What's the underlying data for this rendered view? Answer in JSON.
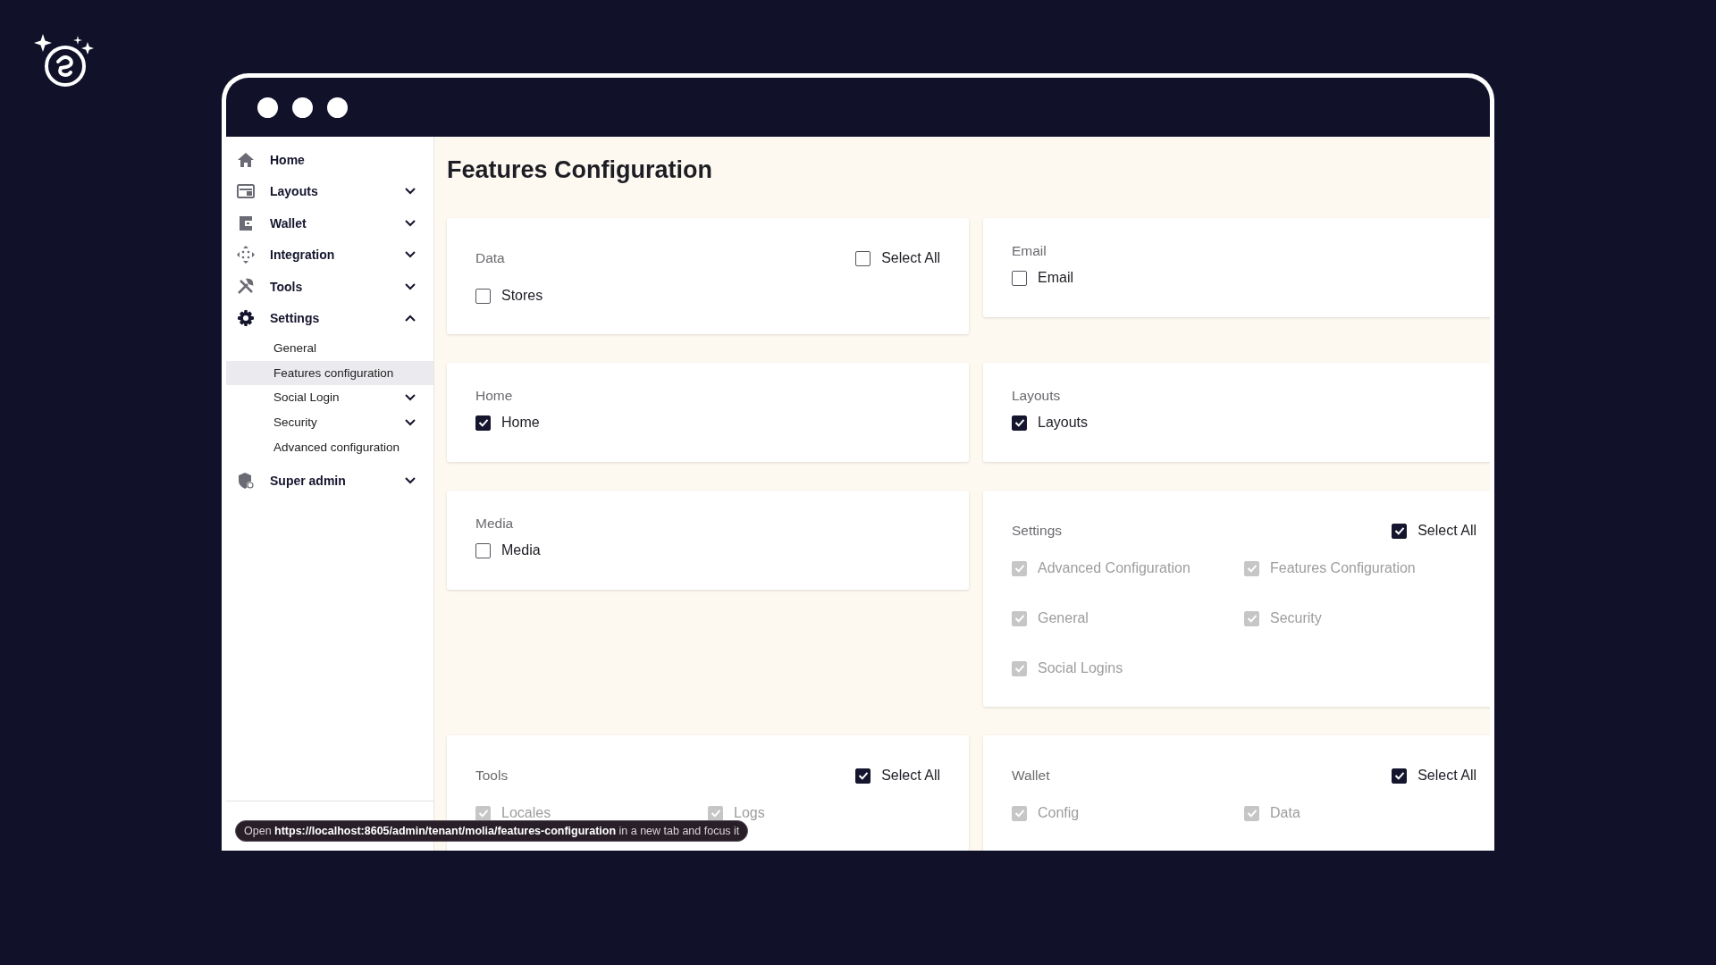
{
  "sidebar": {
    "items": [
      {
        "label": "Home",
        "kind": "link"
      },
      {
        "label": "Layouts",
        "kind": "group",
        "expanded": false
      },
      {
        "label": "Wallet",
        "kind": "group",
        "expanded": false
      },
      {
        "label": "Integration",
        "kind": "group",
        "expanded": false
      },
      {
        "label": "Tools",
        "kind": "group",
        "expanded": false
      },
      {
        "label": "Settings",
        "kind": "group",
        "expanded": true,
        "children": [
          {
            "label": "General",
            "kind": "link",
            "selected": false
          },
          {
            "label": "Features configuration",
            "kind": "link",
            "selected": true
          },
          {
            "label": "Social Login",
            "kind": "group",
            "selected": false
          },
          {
            "label": "Security",
            "kind": "group",
            "selected": false
          },
          {
            "label": "Advanced configuration",
            "kind": "link",
            "selected": false
          }
        ]
      },
      {
        "label": "Super admin",
        "kind": "group",
        "expanded": false
      }
    ]
  },
  "page": {
    "title": "Features Configuration"
  },
  "cards": [
    {
      "title": "Data",
      "select_all": {
        "label": "Select All",
        "checked": false
      },
      "options": [
        {
          "label": "Stores",
          "checked": false,
          "disabled": false
        }
      ]
    },
    {
      "title": "Email",
      "options": [
        {
          "label": "Email",
          "checked": false,
          "disabled": false
        }
      ]
    },
    {
      "title": "Home",
      "options": [
        {
          "label": "Home",
          "checked": true,
          "disabled": false
        }
      ]
    },
    {
      "title": "Layouts",
      "options": [
        {
          "label": "Layouts",
          "checked": true,
          "disabled": false
        }
      ]
    },
    {
      "title": "Media",
      "options": [
        {
          "label": "Media",
          "checked": false,
          "disabled": false
        }
      ]
    },
    {
      "title": "Settings",
      "select_all": {
        "label": "Select All",
        "checked": true
      },
      "options": [
        {
          "label": "Advanced Configuration",
          "checked": true,
          "disabled": true
        },
        {
          "label": "Features Configuration",
          "checked": true,
          "disabled": true
        },
        {
          "label": "General",
          "checked": true,
          "disabled": true
        },
        {
          "label": "Security",
          "checked": true,
          "disabled": true
        },
        {
          "label": "Social Logins",
          "checked": true,
          "disabled": true
        }
      ]
    },
    {
      "title": "Tools",
      "select_all": {
        "label": "Select All",
        "checked": true
      },
      "options": [
        {
          "label": "Locales",
          "checked": true,
          "disabled": true
        },
        {
          "label": "Logs",
          "checked": true,
          "disabled": true
        }
      ]
    },
    {
      "title": "Wallet",
      "select_all": {
        "label": "Select All",
        "checked": true
      },
      "options": [
        {
          "label": "Config",
          "checked": true,
          "disabled": true
        },
        {
          "label": "Data",
          "checked": true,
          "disabled": true
        }
      ]
    }
  ],
  "tooltip": {
    "text": "Open **https://localhost:8605/admin/tenant/molia/features-configuration** in a new tab and focus it"
  }
}
